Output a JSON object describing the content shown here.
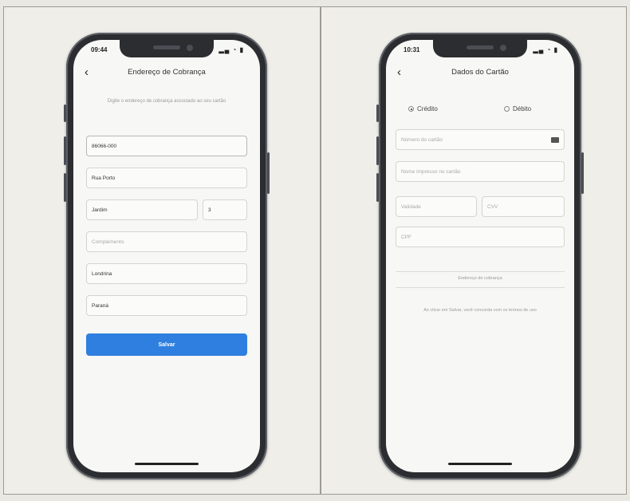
{
  "left_phone": {
    "status_time": "09:44",
    "status_icons": "▂▄ ◔ ▮",
    "title": "Endereço de Cobrança",
    "hint": "Digite o endereço de cobrança associado ao seu cartão",
    "fields": {
      "cep": "86066-000",
      "rua": "Rua Porto",
      "bairro": "Jardim",
      "numero": "3",
      "complemento": "Complemento",
      "cidade": "Londrina",
      "estado": "Paraná"
    },
    "button_label": "Salvar"
  },
  "right_phone": {
    "status_time": "10:31",
    "status_icons": "▂▄ ◔ ▮",
    "title": "Dados do Cartão",
    "radio_credit": "Crédito",
    "radio_debit": "Débito",
    "fields": {
      "card_number": "Número do cartão",
      "card_name": "Nome impresso no cartão",
      "expiry": "Validade",
      "cvv": "CVV",
      "cpf": "CPF"
    },
    "address_label": "Endereço de cobrança",
    "terms": "Ao clicar em Salvar, você concorda com os termos de uso"
  }
}
